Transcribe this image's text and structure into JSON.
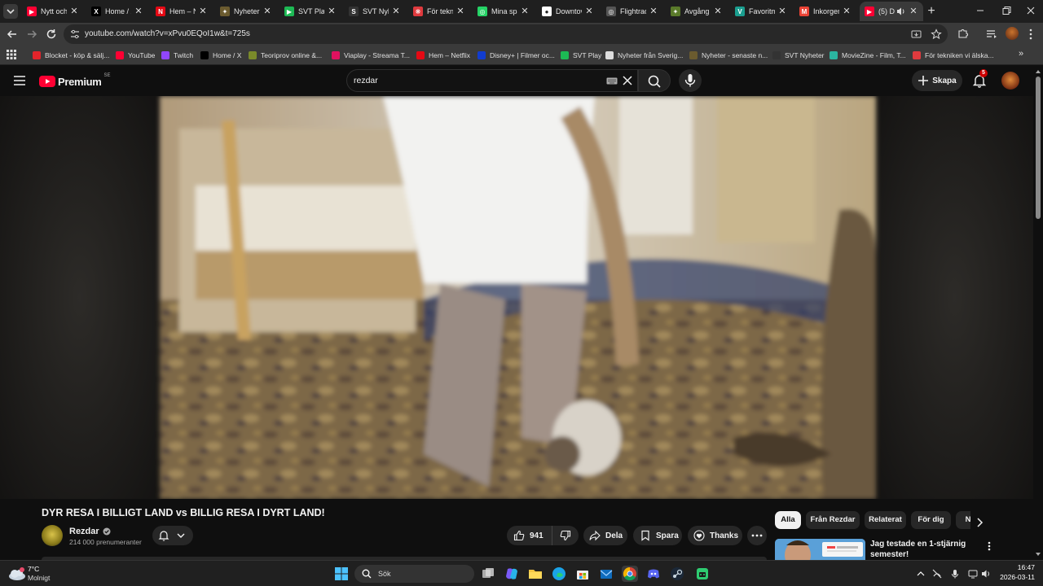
{
  "browser": {
    "tabs": [
      {
        "title": "Nytt och",
        "color": "#ff0033",
        "glyph": "▶"
      },
      {
        "title": "Home / X",
        "color": "#000000",
        "glyph": "X"
      },
      {
        "title": "Hem – N",
        "color": "#e50914",
        "glyph": "N"
      },
      {
        "title": "Nyheter",
        "color": "#6b5b2f",
        "glyph": "✦"
      },
      {
        "title": "SVT Play",
        "color": "#1db954",
        "glyph": "▶"
      },
      {
        "title": "SVT Nyh",
        "color": "#333333",
        "glyph": "S"
      },
      {
        "title": "För tekni",
        "color": "#e03a3e",
        "glyph": "❋"
      },
      {
        "title": "Mina spa",
        "color": "#25d366",
        "glyph": "◎"
      },
      {
        "title": "Downtov",
        "color": "#ffffff",
        "glyph": "●"
      },
      {
        "title": "Flightrad",
        "color": "#555555",
        "glyph": "◎"
      },
      {
        "title": "Avgång",
        "color": "#5a7a2a",
        "glyph": "✦"
      },
      {
        "title": "Favoritm",
        "color": "#1a9e8f",
        "glyph": "V"
      },
      {
        "title": "Inkorgen",
        "color": "#ea4335",
        "glyph": "M"
      },
      {
        "title": "(5) D",
        "color": "#ff0033",
        "glyph": "▶"
      }
    ],
    "url": "youtube.com/watch?v=xPvu0EQoI1w&t=725s",
    "bookmarks": [
      {
        "label": "Blocket - köp & sälj...",
        "color": "#e3242b"
      },
      {
        "label": "YouTube",
        "color": "#ff0033"
      },
      {
        "label": "Twitch",
        "color": "#9146ff"
      },
      {
        "label": "Home / X",
        "color": "#000000"
      },
      {
        "label": "Teoriprov online &...",
        "color": "#7a8a2a"
      },
      {
        "label": "Viaplay - Streama T...",
        "color": "#e0115f"
      },
      {
        "label": "Hem – Netflix",
        "color": "#e50914"
      },
      {
        "label": "Disney+ | Filmer oc...",
        "color": "#113ccf"
      },
      {
        "label": "SVT Play",
        "color": "#1db954"
      },
      {
        "label": "Nyheter från Sverig...",
        "color": "#dddddd"
      },
      {
        "label": "Nyheter - senaste n...",
        "color": "#6b5b2f"
      },
      {
        "label": "SVT Nyheter",
        "color": "#333333"
      },
      {
        "label": "MovieZine - Film, T...",
        "color": "#2bb5a0"
      },
      {
        "label": "För tekniken vi älska...",
        "color": "#e03a3e"
      }
    ]
  },
  "youtube": {
    "logo_text": "Premium",
    "logo_region": "SE",
    "search_value": "rezdar",
    "create_label": "Skapa",
    "notification_count": "5",
    "video_title": "DYR RESA I BILLIGT LAND vs BILLIG RESA I DYRT LAND!",
    "channel_name": "Rezdar",
    "subscribers": "214 000 prenumeranter",
    "like_count": "941",
    "share_label": "Dela",
    "save_label": "Spara",
    "thanks_label": "Thanks",
    "chips": [
      "Alla",
      "Från Rezdar",
      "Relaterat",
      "För dig",
      "N"
    ],
    "recommended_title": "Jag testade en 1-stjärnig semester!"
  },
  "taskbar": {
    "weather_temp": "7°C",
    "weather_desc": "Molnigt",
    "search_label": "Sök",
    "time": "16:47",
    "date": "2026-03-11"
  }
}
